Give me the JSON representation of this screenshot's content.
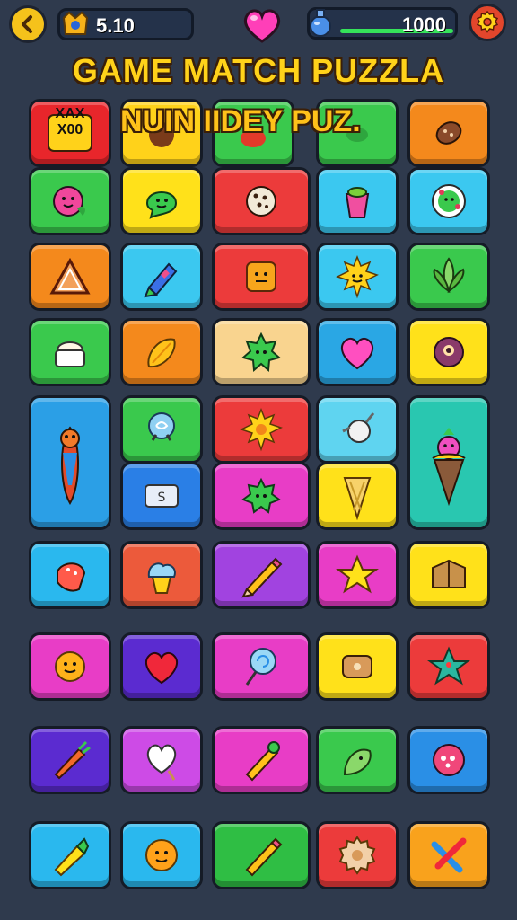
{
  "hud": {
    "score_value": "5.10",
    "gems_value": "1000",
    "gems_progress": 0.9
  },
  "title": "GAME MATCH PUZZLA",
  "banner_text": "NUIN IIDEY PUZ.",
  "badge": {
    "line1": "XAX",
    "line2": "X00"
  },
  "keycap_label": "S",
  "colors": {
    "background": "#2f3a4d",
    "title_yellow": "#ffd21a",
    "progress_green": "#35e35a"
  },
  "tiles": [
    {
      "name": "badge-tile",
      "color": "#e8262b",
      "icon": "x-badge"
    },
    {
      "name": "bomb-tile",
      "color": "#ffd21a",
      "icon": "bomb"
    },
    {
      "name": "leaf-tile",
      "color": "#3ac94d",
      "icon": "leaf"
    },
    {
      "name": "cookie-tile",
      "color": "#f4891c",
      "icon": "cookie"
    },
    {
      "name": "berry-tile",
      "color": "#3ac94d",
      "icon": "berry-face"
    },
    {
      "name": "slime-tile",
      "color": "#ffe11a",
      "icon": "slime-face"
    },
    {
      "name": "choco-cookie-tile",
      "color": "#ec3b3b",
      "icon": "choco-cookie"
    },
    {
      "name": "cupcake-tile",
      "color": "#3bc8f0",
      "icon": "cup"
    },
    {
      "name": "donut-tile",
      "color": "#3bc8f0",
      "icon": "donut-face"
    },
    {
      "name": "pizza-tile",
      "color": "#f4891c",
      "icon": "triangle"
    },
    {
      "name": "crayon-tile",
      "color": "#3bc8f0",
      "icon": "crayon"
    },
    {
      "name": "block-tile",
      "color": "#ec3b3b",
      "icon": "block-face"
    },
    {
      "name": "sun-tile",
      "color": "#3bc8f0",
      "icon": "sun-face"
    },
    {
      "name": "plant-tile",
      "color": "#3ac94d",
      "icon": "plant"
    },
    {
      "name": "cream-tile",
      "color": "#3ac94d",
      "icon": "cream-cup"
    },
    {
      "name": "mango-tile",
      "color": "#f4891c",
      "icon": "mango"
    },
    {
      "name": "star-blob-tile",
      "color": "#f9d48f",
      "icon": "green-blob"
    },
    {
      "name": "heart-tile",
      "color": "#2aa7e4",
      "icon": "pink-heart"
    },
    {
      "name": "eye-tile",
      "color": "#ffe11a",
      "icon": "eye-ball"
    },
    {
      "name": "fish-tile",
      "color": "#2b9fe6",
      "icon": "fish"
    },
    {
      "name": "orb-tile",
      "color": "#3ac94d",
      "icon": "orb"
    },
    {
      "name": "sunflower-tile",
      "color": "#ec3b3b",
      "icon": "sunflower"
    },
    {
      "name": "keycap-tile",
      "color": "#2a7fe6",
      "icon": "keycap"
    },
    {
      "name": "green-monster-tile",
      "color": "#e83dc6",
      "icon": "green-monster"
    },
    {
      "name": "rocket-tile",
      "color": "#5fd4f0",
      "icon": "rocket"
    },
    {
      "name": "cone-tile",
      "color": "#ffe11a",
      "icon": "cone"
    },
    {
      "name": "icecream-monster-tile",
      "color": "#29c7b0",
      "icon": "icecream"
    },
    {
      "name": "jelly-tile",
      "color": "#2ab8ee",
      "icon": "jelly"
    },
    {
      "name": "cupcake-blue-tile",
      "color": "#ec5a3b",
      "icon": "cupcake"
    },
    {
      "name": "pencil-tile",
      "color": "#a143e0",
      "icon": "pencil"
    },
    {
      "name": "star-tile",
      "color": "#e83dc6",
      "icon": "star"
    },
    {
      "name": "box-tile",
      "color": "#ffe11a",
      "icon": "box"
    },
    {
      "name": "candy-face-tile",
      "color": "#e83dc6",
      "icon": "candy-face"
    },
    {
      "name": "red-heart-tile",
      "color": "#5b2bd0",
      "icon": "red-heart"
    },
    {
      "name": "lollipop-tile",
      "color": "#e83dc6",
      "icon": "lollipop"
    },
    {
      "name": "toast-tile",
      "color": "#ffe11a",
      "icon": "toast"
    },
    {
      "name": "star-leaf-tile",
      "color": "#ec3b3b",
      "icon": "star-leaf"
    },
    {
      "name": "carrot-tile",
      "color": "#5b2bd0",
      "icon": "carrot"
    },
    {
      "name": "white-heart-tile",
      "color": "#cd4be6",
      "icon": "white-heart"
    },
    {
      "name": "pencil-pink-tile",
      "color": "#e83dc6",
      "icon": "pencil-green"
    },
    {
      "name": "pepper-tile",
      "color": "#3ac94d",
      "icon": "pepper"
    },
    {
      "name": "pink-ball-tile",
      "color": "#2a8fe6",
      "icon": "pink-ball"
    },
    {
      "name": "corn-tile",
      "color": "#2ab8ee",
      "icon": "corn"
    },
    {
      "name": "orange-face-tile",
      "color": "#2ab8ee",
      "icon": "orange-face"
    },
    {
      "name": "green-pencil-tile",
      "color": "#2fbe44",
      "icon": "pencil-yellow"
    },
    {
      "name": "gear-cookie-tile",
      "color": "#ec3b3b",
      "icon": "gear-cookie"
    },
    {
      "name": "cross-tile",
      "color": "#f9a21c",
      "icon": "cross"
    }
  ]
}
